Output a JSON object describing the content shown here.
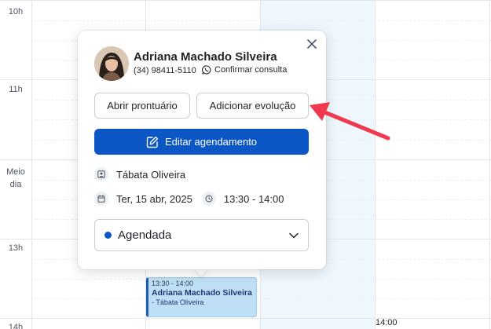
{
  "calendar": {
    "hours": [
      "10h",
      "11h",
      "Meio dia",
      "13h",
      "14h"
    ],
    "event": {
      "time": "13:30 - 14:00",
      "title": "Adriana Machado Silveira",
      "professional": "Tábata Oliveira"
    },
    "next_slot_time": "14:00"
  },
  "popover": {
    "patient_name": "Adriana Machado Silveira",
    "phone": "(34) 98411-5110",
    "whatsapp_label": "Confirmar consulta",
    "open_record_label": "Abrir prontuário",
    "add_evolution_label": "Adicionar evolução",
    "edit_label": "Editar agendamento",
    "professional": "Tábata Oliveira",
    "date": "Ter, 15 abr, 2025",
    "time_range": "13:30 - 14:00",
    "status": "Agendada"
  },
  "colors": {
    "primary": "#0b57c5",
    "today_column": "#eef6fe",
    "event_bg": "#bfdff7",
    "annotation_arrow": "#f0384f",
    "whatsapp": "#1f2328"
  },
  "icons": [
    "close-icon",
    "whatsapp-icon",
    "edit-icon",
    "user-icon",
    "calendar-icon",
    "clock-icon",
    "chevron-down-icon"
  ]
}
